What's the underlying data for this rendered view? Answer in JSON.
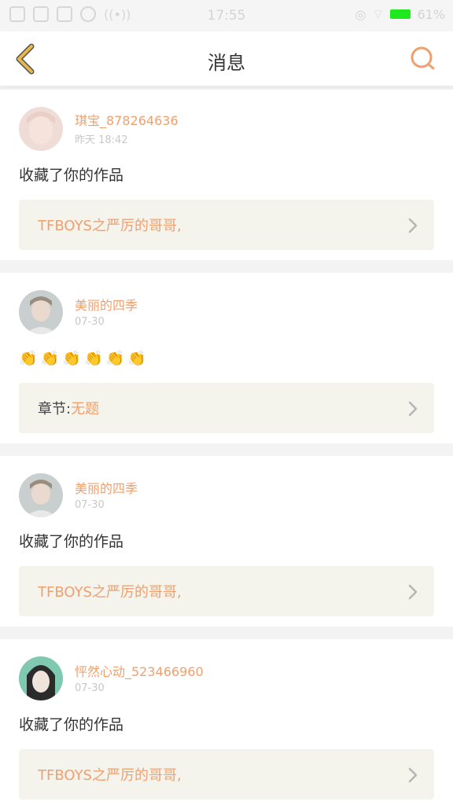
{
  "status_bar": {
    "time": "17:55",
    "battery": "61%"
  },
  "header": {
    "title": "消息"
  },
  "messages": [
    {
      "username": "琪宝_878264636",
      "time": "昨天 18:42",
      "action": "收藏了你的作品",
      "reference": "TFBOYS之严厉的哥哥,"
    },
    {
      "username": "美丽的四季",
      "time": "07-30",
      "action_emoji": [
        "👏",
        "👏",
        "👏",
        "👏",
        "👏",
        "👏"
      ],
      "reference_label": "章节:",
      "reference": "无题"
    },
    {
      "username": "美丽的四季",
      "time": "07-30",
      "action": "收藏了你的作品",
      "reference": "TFBOYS之严厉的哥哥,"
    },
    {
      "username": "怦然心动_523466960",
      "time": "07-30",
      "action": "收藏了你的作品",
      "reference": "TFBOYS之严厉的哥哥,"
    }
  ],
  "colors": {
    "accent": "#f0a06e",
    "back_arrow": "#e8b64a",
    "reference_bg": "#f4f3ec",
    "battery": "#1ee81e"
  }
}
